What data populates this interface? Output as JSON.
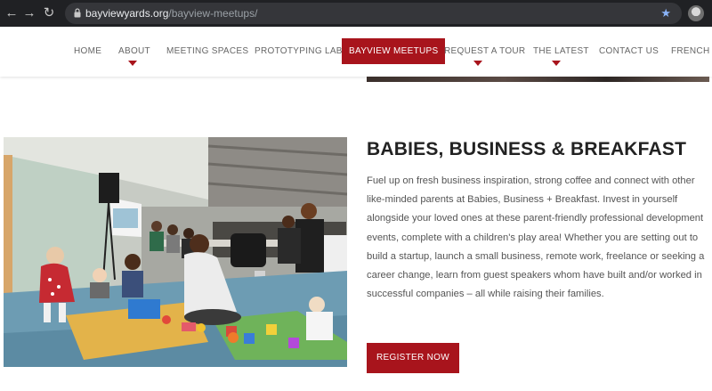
{
  "browser": {
    "url_host": "bayviewyards.org",
    "url_path": "/bayview-meetups/",
    "back_icon": "arrow-left-icon",
    "forward_icon": "arrow-right-icon",
    "reload_icon": "reload-icon",
    "lock_icon": "lock-icon",
    "star_icon": "star-icon",
    "star_color": "#8ab4f8"
  },
  "nav": {
    "items": [
      {
        "label": "HOME"
      },
      {
        "label": "ABOUT",
        "has_dropdown": true
      },
      {
        "label": "MEETING SPACES"
      },
      {
        "label": "PROTOTYPING LAB"
      },
      {
        "label": "BAYVIEW MEETUPS",
        "active": true
      },
      {
        "label": "REQUEST A TOUR",
        "has_dropdown": true
      },
      {
        "label": "THE LATEST",
        "has_dropdown": true
      },
      {
        "label": "CONTACT US"
      },
      {
        "label": "FRENCH"
      }
    ],
    "accent_color": "#a8141c"
  },
  "event": {
    "title": "BABIES, BUSINESS & BREAKFAST",
    "description": "Fuel up on fresh business inspiration, strong coffee and connect with other like-minded parents at Babies, Business + Breakfast. Invest in yourself alongside your loved ones at these parent-friendly professional development events, complete with a children's play area! Whether you are setting out to build a startup, launch a small business, remote work, freelance or seeking a career change, learn from guest speakers whom have built and/or worked in successful companies – all while raising their families.",
    "register_label": "REGISTER NOW"
  }
}
